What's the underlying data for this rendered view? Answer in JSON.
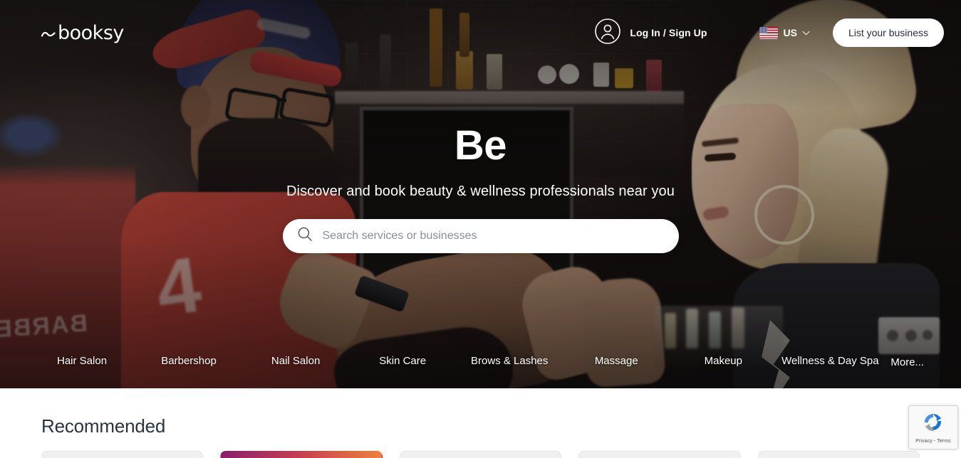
{
  "brand": {
    "logo_text": "booksy",
    "logo_icon": "booksy-swoosh-icon"
  },
  "header": {
    "account_icon": "user-avatar-icon",
    "login_label": "Log In / Sign Up",
    "locale": {
      "flag_icon": "us-flag-icon",
      "code": "US",
      "chevron_icon": "chevron-down-icon"
    },
    "list_business_label": "List your business"
  },
  "hero": {
    "title": "Be",
    "subtitle": "Discover and book beauty & wellness professionals near you",
    "search": {
      "icon": "search-icon",
      "placeholder": "Search services or businesses",
      "value": ""
    },
    "categories": [
      {
        "label": "Hair Salon"
      },
      {
        "label": "Barbershop"
      },
      {
        "label": "Nail Salon"
      },
      {
        "label": "Skin Care"
      },
      {
        "label": "Brows & Lashes"
      },
      {
        "label": "Massage"
      },
      {
        "label": "Makeup"
      },
      {
        "label": "Wellness & Day Spa"
      },
      {
        "label": "More..."
      }
    ]
  },
  "main": {
    "section_title": "Recommended"
  },
  "recaptcha": {
    "logo_icon": "recaptcha-icon",
    "text": "Privacy - Terms"
  },
  "colors": {
    "accent_white": "#ffffff",
    "text_dark": "#2b3340",
    "placeholder": "#8a8f98",
    "card_gradient_start": "#8c1d6e",
    "card_gradient_end": "#ef7f3e",
    "flag_red": "#c7202f",
    "flag_blue": "#2b3a77"
  }
}
